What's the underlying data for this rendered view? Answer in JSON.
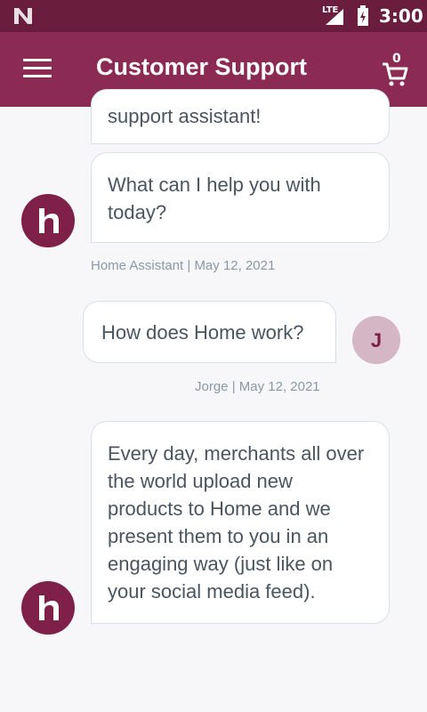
{
  "status_bar": {
    "network": "LTE",
    "time": "3:00"
  },
  "app_bar": {
    "title": "Customer Support",
    "cart_count": "0"
  },
  "messages": [
    {
      "sender": "bot",
      "text": "support assistant!"
    },
    {
      "sender": "bot",
      "text": "What can I help you with today?"
    },
    {
      "sender": "bot_meta",
      "text": "Home Assistant | May 12, 2021"
    },
    {
      "sender": "user",
      "avatar_letter": "J",
      "text": "How does Home work?"
    },
    {
      "sender": "user_meta",
      "text": "Jorge | May 12, 2021"
    },
    {
      "sender": "bot",
      "text": "Every day, merchants all over the world upload new products to Home and we present them to you in an engaging way (just like on your social media feed)."
    }
  ],
  "colors": {
    "status_bar": "#6b1d3e",
    "app_bar": "#8b2a52",
    "bot_avatar": "#7f2049",
    "user_avatar": "#d5b6c4",
    "background": "#f7f7f9"
  },
  "icons": [
    "n-logo-icon",
    "lte-signal-icon",
    "battery-charging-icon",
    "menu-icon",
    "cart-icon",
    "home-logo-icon"
  ]
}
